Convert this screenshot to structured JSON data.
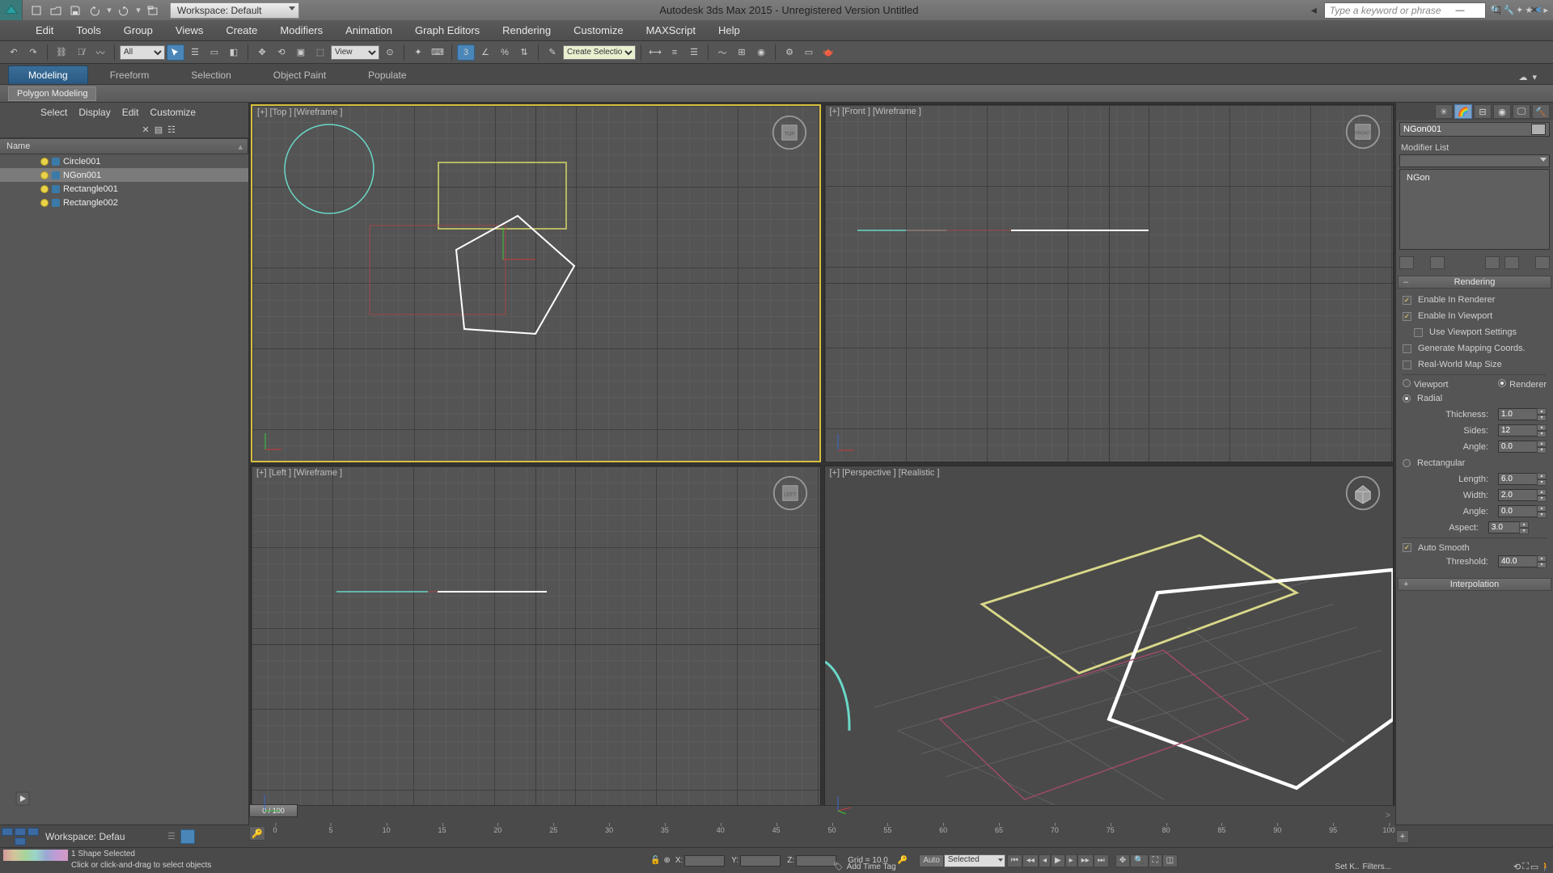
{
  "app": {
    "title": "Autodesk 3ds Max  2015  - Unregistered Version    Untitled"
  },
  "workspace_selector": "Workspace: Default",
  "search": {
    "placeholder": "Type a keyword or phrase"
  },
  "menubar": [
    "Edit",
    "Tools",
    "Group",
    "Views",
    "Create",
    "Modifiers",
    "Animation",
    "Graph Editors",
    "Rendering",
    "Customize",
    "MAXScript",
    "Help"
  ],
  "toolbar_filter": {
    "value": "All"
  },
  "toolbar_refsys": {
    "value": "View"
  },
  "toolbar_named_sel": {
    "value": "Create Selection S"
  },
  "ribbon": {
    "tabs": [
      "Modeling",
      "Freeform",
      "Selection",
      "Object Paint",
      "Populate"
    ],
    "active": 0,
    "panel": "Polygon Modeling"
  },
  "scene_menu": [
    "Select",
    "Display",
    "Edit",
    "Customize"
  ],
  "scene_header": "Name",
  "scene_nodes": [
    {
      "name": "Circle001",
      "selected": false
    },
    {
      "name": "NGon001",
      "selected": true
    },
    {
      "name": "Rectangle001",
      "selected": false
    },
    {
      "name": "Rectangle002",
      "selected": false
    }
  ],
  "viewports": {
    "top": {
      "label": "[+] [Top ] [Wireframe ]"
    },
    "front": {
      "label": "[+] [Front ] [Wireframe ]"
    },
    "left": {
      "label": "[+] [Left ] [Wireframe ]"
    },
    "persp": {
      "label": "[+] [Perspective ] [Realistic ]"
    }
  },
  "cmd": {
    "object_name": "NGon001",
    "modlist_label": "Modifier List",
    "stack_top": "NGon",
    "rollouts": {
      "rendering": {
        "title": "Rendering",
        "enable_renderer": "Enable In Renderer",
        "enable_viewport": "Enable In Viewport",
        "use_viewport": "Use Viewport Settings",
        "gen_map": "Generate Mapping Coords.",
        "real_world": "Real-World Map Size",
        "viewport_lbl": "Viewport",
        "renderer_lbl": "Renderer",
        "radial_lbl": "Radial",
        "thickness_lbl": "Thickness:",
        "thickness": "1.0",
        "sides_lbl": "Sides:",
        "sides": "12",
        "angle_lbl": "Angle:",
        "angle": "0.0",
        "rect_lbl": "Rectangular",
        "length_lbl": "Length:",
        "length": "6.0",
        "width_lbl": "Width:",
        "width": "2.0",
        "angle2_lbl": "Angle:",
        "angle2": "0.0",
        "aspect_lbl": "Aspect:",
        "aspect": "3.0",
        "autosmooth_lbl": "Auto Smooth",
        "threshold_lbl": "Threshold:",
        "threshold": "40.0"
      },
      "interp": {
        "title": "Interpolation"
      }
    }
  },
  "time": {
    "frame": "0 / 100",
    "ticks": [
      "0",
      "5",
      "10",
      "15",
      "20",
      "25",
      "30",
      "35",
      "40",
      "45",
      "50",
      "55",
      "60",
      "65",
      "70",
      "75",
      "80",
      "85",
      "90",
      "95",
      "100"
    ]
  },
  "status": {
    "sel_msg": "1 Shape Selected",
    "prompt": "Click or click-and-drag to select objects",
    "x_lbl": "X:",
    "y_lbl": "Y:",
    "z_lbl": "Z:",
    "grid": "Grid = 10.0",
    "auto": "Auto",
    "selected": "Selected",
    "setk": "Set K..",
    "filters": "Filters...",
    "timetag": "Add Time Tag"
  },
  "workspace_footer": "Workspace: Defau"
}
